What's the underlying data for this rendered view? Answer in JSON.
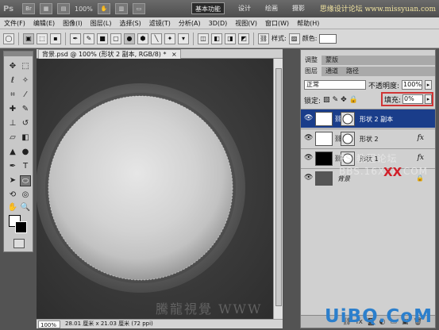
{
  "titlebar": {
    "logo": "Ps",
    "zoom": "100%",
    "workspaces": [
      "基本功能",
      "设计",
      "绘画",
      "摄影"
    ],
    "watermark": "思缘设计论坛 www.missyuan.com"
  },
  "menu": [
    "文件(F)",
    "编辑(E)",
    "图像(I)",
    "图层(L)",
    "选择(S)",
    "滤镜(T)",
    "分析(A)",
    "3D(D)",
    "视图(V)",
    "窗口(W)",
    "帮助(H)"
  ],
  "options": {
    "style_label": "样式:",
    "color_label": "颜色:"
  },
  "document": {
    "tab_title": "背景.psd @ 100% (形状 2 副本, RGB/8) *",
    "close": "×",
    "zoom": "100%",
    "status": "28.01 厘米 x 21.03 厘米 (72 ppi)",
    "canvas_watermark": "騰龍視覺 WWW"
  },
  "panel": {
    "tabs_top": [
      "调整",
      "蒙版"
    ],
    "tabs_bottom": [
      "图层",
      "通道",
      "路径"
    ],
    "blend_mode": "正常",
    "opacity_label": "不透明度:",
    "opacity_value": "100%",
    "lock_label": "锁定:",
    "fill_label": "填充:",
    "fill_value": "0%",
    "layers": [
      {
        "name": "形状 2 副本",
        "selected": true,
        "has_fx": false,
        "thumb": "#ffffff"
      },
      {
        "name": "形状 2",
        "selected": false,
        "has_fx": true,
        "thumb": "#ffffff"
      },
      {
        "name": "形状 1",
        "selected": false,
        "has_fx": true,
        "thumb": "#000000"
      },
      {
        "name": "背景",
        "selected": false,
        "has_fx": false,
        "thumb": "#555555"
      }
    ],
    "forum_watermark_1": "PS 教程论坛",
    "forum_watermark_2": "BBS.16XX8.COM",
    "forum_xx": "XX"
  },
  "brand_watermark": "UiBQ.CoM",
  "colors": {
    "accent_red": "#d03535",
    "selection_blue": "#1a3d8a",
    "brand_blue": "#2c7fcc"
  }
}
